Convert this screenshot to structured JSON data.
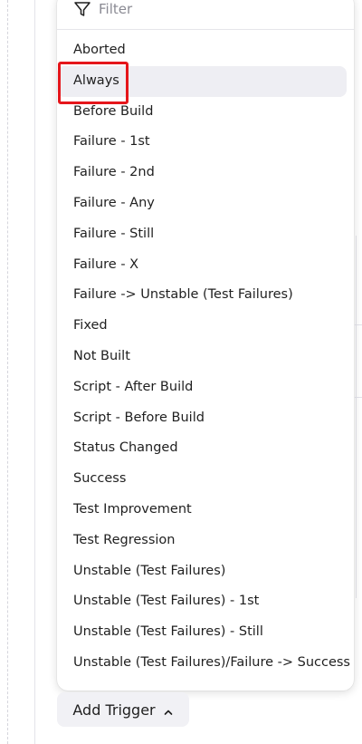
{
  "filter": {
    "placeholder": "Filter",
    "value": ""
  },
  "options": [
    "Aborted",
    "Always",
    "Before Build",
    "Failure - 1st",
    "Failure - 2nd",
    "Failure - Any",
    "Failure - Still",
    "Failure - X",
    "Failure -> Unstable (Test Failures)",
    "Fixed",
    "Not Built",
    "Script - After Build",
    "Script - Before Build",
    "Status Changed",
    "Success",
    "Test Improvement",
    "Test Regression",
    "Unstable (Test Failures)",
    "Unstable (Test Failures) - 1st",
    "Unstable (Test Failures) - Still",
    "Unstable (Test Failures)/Failure -> Success"
  ],
  "hovered_option": "Always",
  "add_trigger_label": "Add Trigger",
  "colors": {
    "highlight": "#e5161b",
    "hover_bg": "#eeeef3"
  },
  "icons": {
    "filter": "funnel-icon",
    "add_trigger": "chevron-up-icon"
  }
}
